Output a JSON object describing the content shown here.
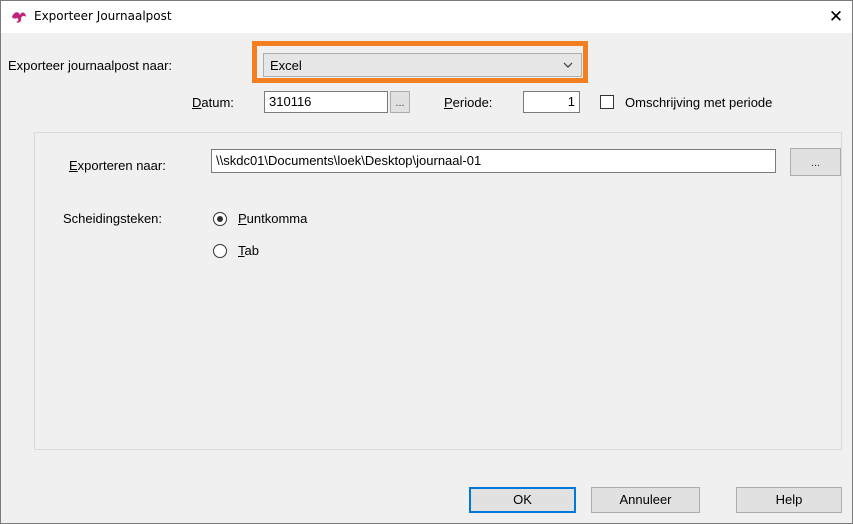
{
  "window": {
    "title": "Exporteer Journaalpost",
    "close_glyph": "✕",
    "icon": "app-logo-icon"
  },
  "form": {
    "export_to_label": "Exporteer journaalpost naar:",
    "export_to_value": "Excel",
    "datum_label_u": "D",
    "datum_label_rest": "atum:",
    "datum_value": "310116",
    "datum_button": "...",
    "periode_label_u": "P",
    "periode_label_rest": "eriode:",
    "periode_value": "1",
    "omschrijving_label": "Omschrijving met periode",
    "omschrijving_checked": false
  },
  "panel": {
    "exporteren_label_u": "E",
    "exporteren_label_rest": "xporteren naar:",
    "path_value": "\\\\skdc01\\Documents\\loek\\Desktop\\journaal-01",
    "browse_button": "...",
    "separator_label": "Scheidingsteken:",
    "options": [
      {
        "u": "P",
        "rest": "untkomma",
        "selected": true
      },
      {
        "u": "T",
        "rest": "ab",
        "selected": false
      }
    ]
  },
  "buttons": {
    "ok": "OK",
    "cancel": "Annuleer",
    "help": "Help"
  },
  "colors": {
    "highlight": "#f47f21",
    "logo": "#c0267a"
  }
}
